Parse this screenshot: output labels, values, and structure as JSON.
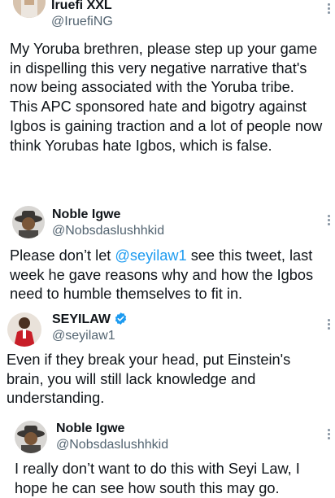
{
  "tweets": [
    {
      "name": "Iruefi XXL",
      "handle": "@IruefiNG",
      "text": "My Yoruba brethren, please step up your game in dispelling this very negative narrative that's now being associated with the Yoruba tribe.\nThis APC sponsored hate and bigotry against Igbos is gaining traction and a lot of people now think Yorubas hate Igbos, which is false."
    },
    {
      "name": "Noble Igwe",
      "handle": "@Nobsdaslushhkid",
      "text_before": "Please don’t let ",
      "mention": "@seyilaw1",
      "text_after": " see this tweet, last week he gave reasons why and how the Igbos need to humble themselves to fit in."
    },
    {
      "name": "SEYILAW",
      "verified": true,
      "handle": "@seyilaw1",
      "text": "Even if they break your head, put Einstein's brain, you will still lack knowledge and understanding."
    },
    {
      "name": "Noble Igwe",
      "handle": "@Nobsdaslushhkid",
      "text": "I really don’t want to do this with Seyi Law, I hope he can see how south this may go."
    }
  ],
  "colors": {
    "mention": "#1d9bf0",
    "handle": "#536471",
    "verified": "#1d9bf0"
  }
}
